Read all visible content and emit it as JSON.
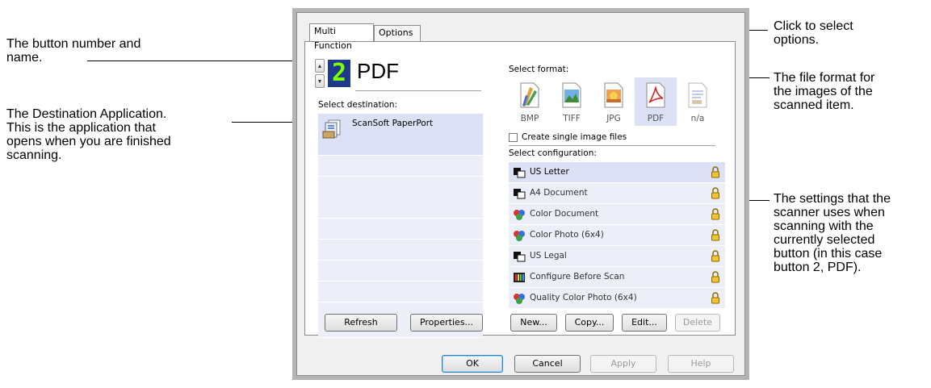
{
  "callouts": {
    "button_name": "The button number and\nname.",
    "destination": "The Destination Application.\nThis is the application that\nopens when you are finished\nscanning.",
    "options": "Click to select\noptions.",
    "format": "The file format for\nthe images of the\nscanned item.",
    "settings": "The settings that the\nscanner uses when\nscanning with the\ncurrently selected\nbutton (in this case\nbutton 2, PDF)."
  },
  "dialog": {
    "tabs": [
      "Multi Function",
      "Options"
    ],
    "button_number": "2",
    "button_name": "PDF",
    "select_destination_label": "Select destination:",
    "destinations": [
      "ScanSoft PaperPort"
    ],
    "select_format_label": "Select format:",
    "formats": [
      "BMP",
      "TIFF",
      "JPG",
      "PDF",
      "n/a"
    ],
    "selected_format": "PDF",
    "single_image_label": "Create single image files",
    "single_image_checked": false,
    "select_configuration_label": "Select configuration:",
    "configurations": [
      "US Letter",
      "A4 Document",
      "Color Document",
      "Color Photo (6x4)",
      "US Legal",
      "Configure Before Scan",
      "Quality Color Photo (6x4)"
    ],
    "selected_configuration": "US Letter",
    "left_buttons": {
      "refresh": "Refresh",
      "properties": "Properties..."
    },
    "config_buttons": {
      "new": "New...",
      "copy": "Copy...",
      "edit": "Edit...",
      "delete": "Delete"
    },
    "footer_buttons": {
      "ok": "OK",
      "cancel": "Cancel",
      "apply": "Apply",
      "help": "Help"
    }
  },
  "icons": {
    "spin_up": "spin-up-arrow",
    "spin_down": "spin-down-arrow",
    "destination": "paperport-icon",
    "lock": "lock-icon"
  },
  "colors": {
    "lcd_background": "#1e3a8a",
    "lcd_digit": "#7fff00",
    "selected_row": "#dde1f5",
    "list_row": "#eceef8"
  }
}
